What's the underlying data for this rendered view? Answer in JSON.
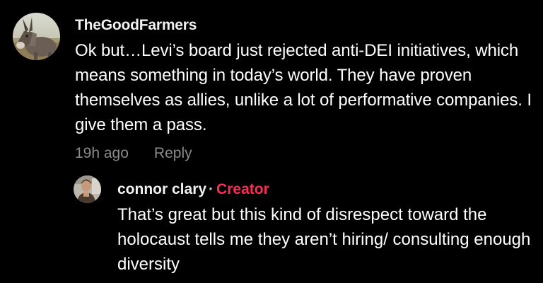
{
  "comments": [
    {
      "username": "TheGoodFarmers",
      "avatar_icon": "donkey-avatar-photo",
      "text": "Ok but…Levi’s board just rejected anti-DEI initiatives, which means something in today’s world. They have proven themselves as allies, unlike a lot of performative companies. I give them a pass.",
      "timestamp": "19h ago",
      "reply_label": "Reply",
      "replies": [
        {
          "username": "connor clary",
          "separator": "·",
          "badge": "Creator",
          "avatar_icon": "person-avatar-photo",
          "text": "That’s great but this kind of disrespect toward the holocaust tells me they aren’t hiring/ consulting enough diversity"
        }
      ]
    }
  ],
  "colors": {
    "background": "#000000",
    "text": "#ffffff",
    "muted": "#8a8a8a",
    "creator_badge": "#fe2c55"
  }
}
